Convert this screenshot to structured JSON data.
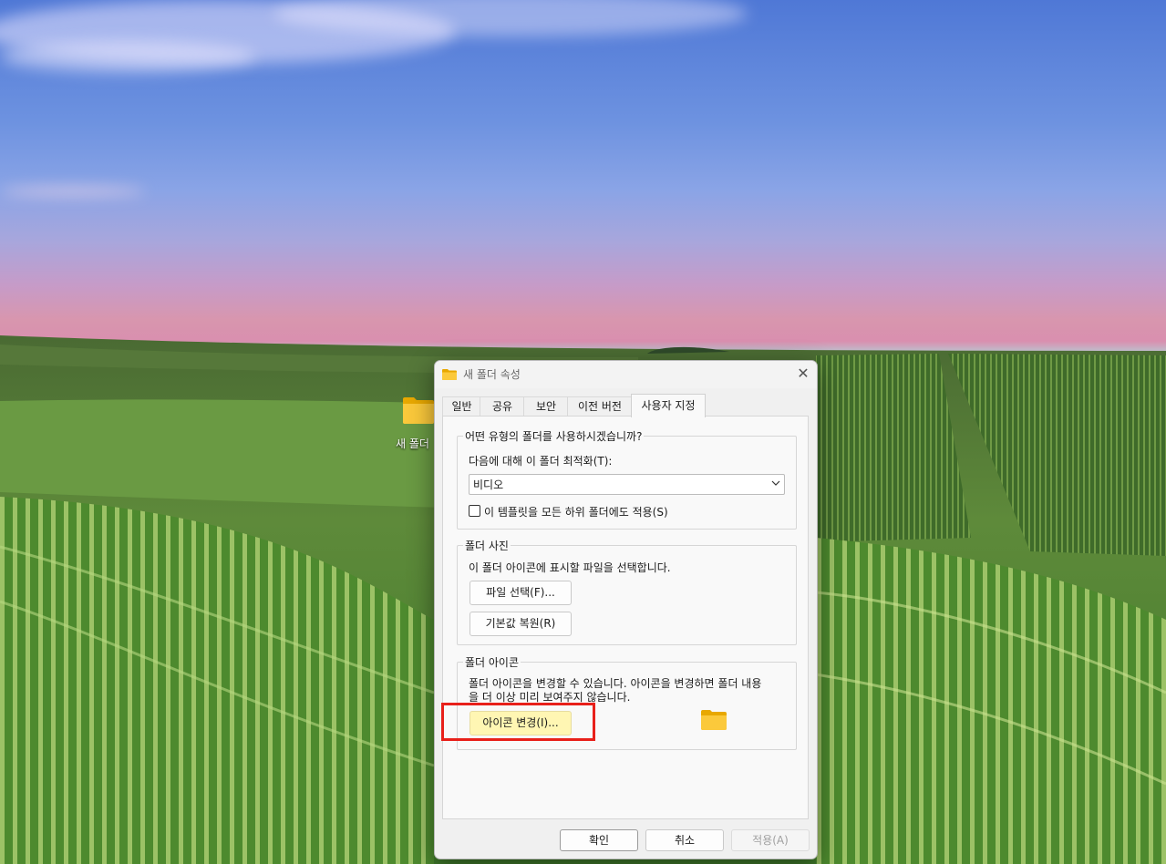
{
  "desktop": {
    "icon_label": "새 폴더"
  },
  "dialog": {
    "title": "새 폴더 속성",
    "close_glyph": "✕",
    "tabs": [
      {
        "label": "일반"
      },
      {
        "label": "공유"
      },
      {
        "label": "보안"
      },
      {
        "label": "이전 버전"
      },
      {
        "label": "사용자 지정",
        "active": true
      }
    ],
    "group_type": {
      "title": "어떤 유형의 폴더를 사용하시겠습니까?",
      "optimize_label": "다음에 대해 이 폴더 최적화(T):",
      "optimize_value": "비디오",
      "apply_template_label": "이 템플릿을 모든 하위 폴더에도 적용(S)",
      "apply_template_checked": false
    },
    "group_picture": {
      "title": "폴더 사진",
      "description": "이 폴더 아이콘에 표시할 파일을 선택합니다.",
      "choose_file_button": "파일 선택(F)...",
      "restore_default_button": "기본값 복원(R)"
    },
    "group_icon": {
      "title": "폴더 아이콘",
      "description_line1": "폴더 아이콘을 변경할 수 있습니다. 아이콘을 변경하면 폴더 내용",
      "description_line2": "을 더 이상  미리 보여주지 않습니다.",
      "change_icon_button": "아이콘 변경(I)..."
    },
    "footer": {
      "ok_button": "확인",
      "cancel_button": "취소",
      "apply_button": "적용(A)"
    }
  },
  "colors": {
    "highlight": "#e8201a",
    "button_highlight": "#fff6b3",
    "folder_yellow": "#f5c33b"
  }
}
